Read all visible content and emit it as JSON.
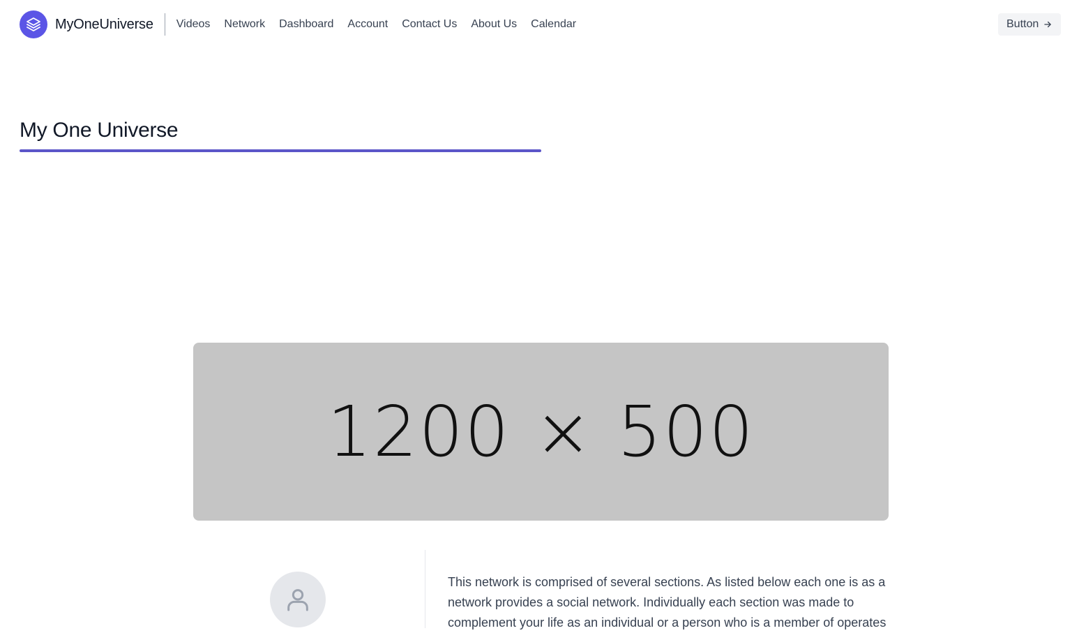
{
  "header": {
    "brand_name": "MyOneUniverse",
    "nav_items": [
      {
        "label": "Videos"
      },
      {
        "label": "Network"
      },
      {
        "label": "Dashboard"
      },
      {
        "label": "Account"
      },
      {
        "label": "Contact Us"
      },
      {
        "label": "About Us"
      },
      {
        "label": "Calendar"
      }
    ],
    "button_label": "Button",
    "button_icon": "arrow-right-icon",
    "logo_icon": "layers-icon"
  },
  "main": {
    "title": "My One Universe",
    "hero_image_label": "1200 × 500",
    "avatar_icon": "user-icon",
    "intro_text": "This network is comprised of several sections. As listed below each one is as a network provides a social network. Individually each section was made to complement your life as an individual or a person who is a member of operates"
  },
  "colors": {
    "accent": "#5b55e6",
    "underline": "#5b55c8",
    "placeholder_gray": "#c5c5c5",
    "avatar_bg": "#e5e7eb",
    "button_bg": "#f3f4f6"
  }
}
